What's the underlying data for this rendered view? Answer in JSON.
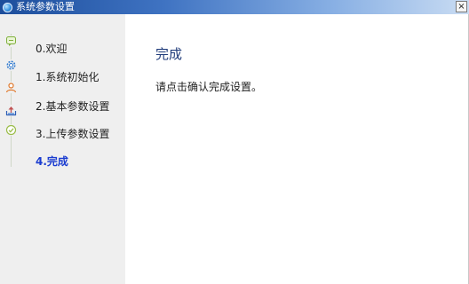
{
  "window": {
    "title": "系统参数设置",
    "close_label": "×"
  },
  "sidebar": {
    "steps": [
      {
        "label": "0.欢迎",
        "icon": "chat-bubble-icon",
        "active": false
      },
      {
        "label": "1.系统初始化",
        "icon": "gear-icon",
        "active": false
      },
      {
        "label": "2.基本参数设置",
        "icon": "user-icon",
        "active": false
      },
      {
        "label": "3.上传参数设置",
        "icon": "upload-icon",
        "active": false
      },
      {
        "label": "4.完成",
        "icon": "check-circle-icon",
        "active": true
      }
    ]
  },
  "content": {
    "title": "完成",
    "message": "请点击确认完成设置。"
  },
  "colors": {
    "active_step": "#1a3cd0",
    "title": "#1f3b7a",
    "sidebar_bg": "#efefef"
  }
}
